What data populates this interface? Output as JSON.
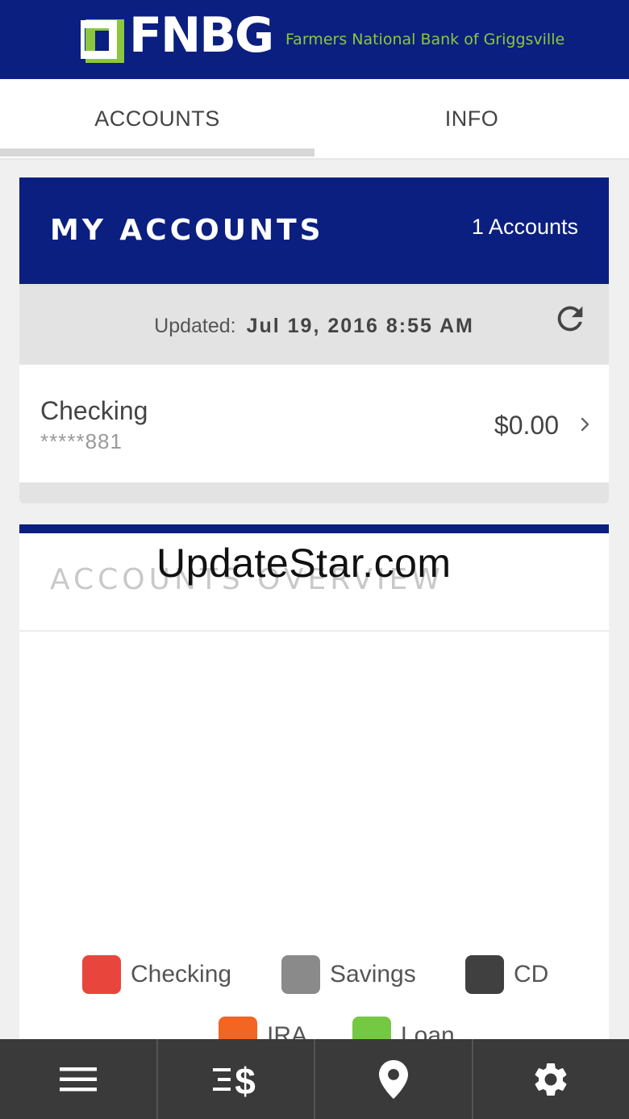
{
  "header": {
    "logo_text": "FNBG",
    "bank_name": "Farmers National Bank of Griggsville"
  },
  "tabs": [
    {
      "label": "ACCOUNTS",
      "active": true
    },
    {
      "label": "INFO",
      "active": false
    }
  ],
  "my_accounts": {
    "title": "MY ACCOUNTS",
    "count_text": "1 Accounts",
    "updated_label": "Updated:",
    "updated_value": "Jul 19, 2016 8:55 AM",
    "accounts": [
      {
        "name": "Checking",
        "number": "*****881",
        "balance": "$0.00"
      }
    ]
  },
  "overview": {
    "title": "ACCOUNTS OVERVIEW",
    "legend": [
      {
        "label": "Checking",
        "color": "#e8453c"
      },
      {
        "label": "Savings",
        "color": "#8a8a8a"
      },
      {
        "label": "CD",
        "color": "#404040"
      },
      {
        "label": "IRA",
        "color": "#f26522"
      },
      {
        "label": "Loan",
        "color": "#74c842"
      }
    ]
  },
  "watermark": "UpdateStar.com",
  "bottom_nav": [
    {
      "icon": "menu-icon"
    },
    {
      "icon": "transfer-dollar-icon"
    },
    {
      "icon": "location-pin-icon"
    },
    {
      "icon": "gear-icon"
    }
  ],
  "colors": {
    "brand_navy": "#0b1f80",
    "brand_green": "#8cc63f"
  }
}
